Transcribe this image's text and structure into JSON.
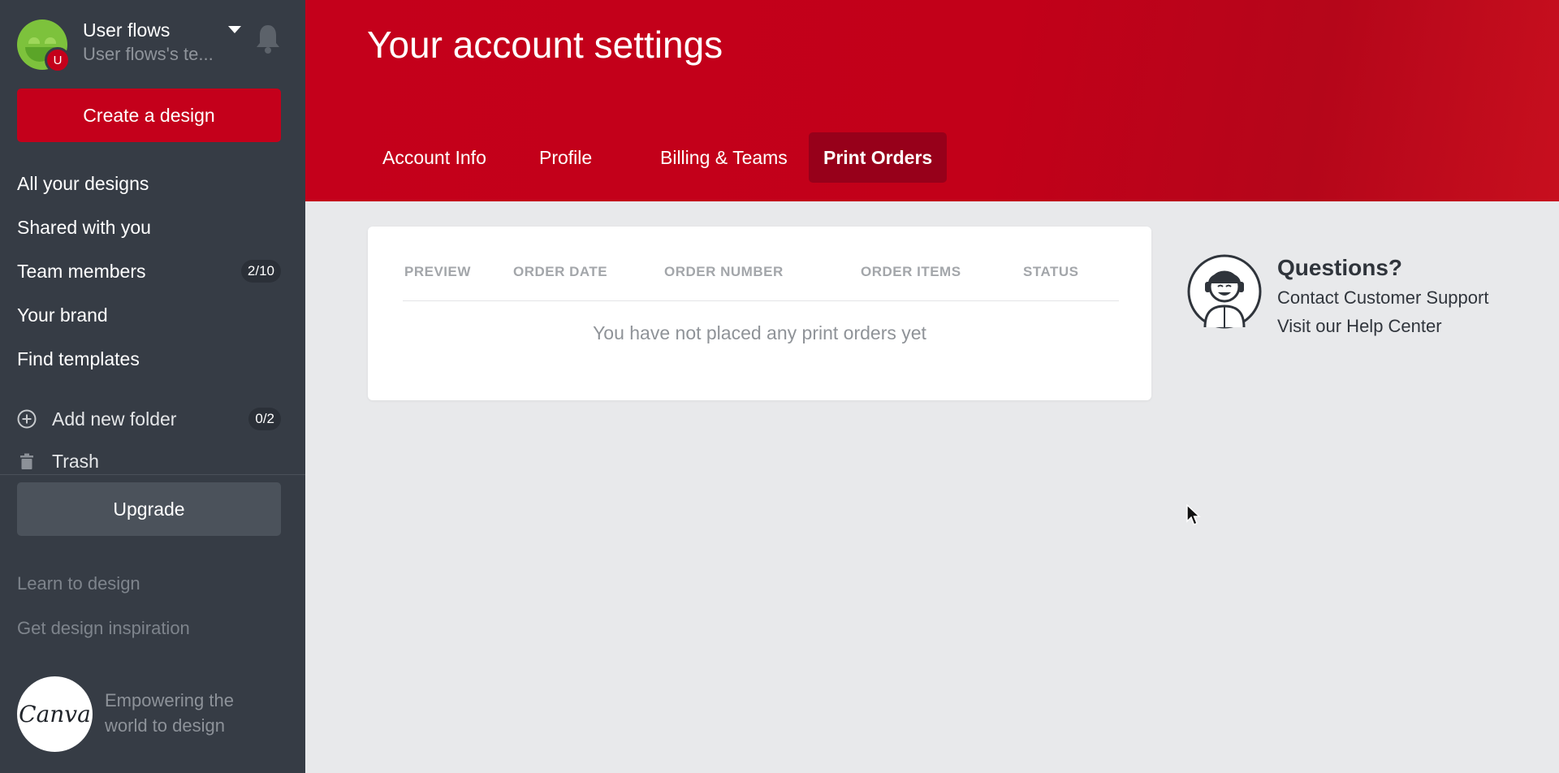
{
  "user": {
    "name": "User flows",
    "team": "User flows's te...",
    "avatar_initial": "U"
  },
  "sidebar": {
    "create_label": "Create a design",
    "nav": [
      {
        "label": "All your designs"
      },
      {
        "label": "Shared with you"
      },
      {
        "label": "Team members",
        "count": "2/10"
      },
      {
        "label": "Your brand"
      },
      {
        "label": "Find templates"
      }
    ],
    "add_folder": {
      "label": "Add new folder",
      "count": "0/2"
    },
    "trash_label": "Trash",
    "upgrade_label": "Upgrade",
    "footer_links": [
      "Learn to design",
      "Get design inspiration"
    ],
    "logo_text": "Canva",
    "tagline": "Empowering the world to design"
  },
  "header": {
    "title": "Your account settings",
    "tabs": [
      {
        "label": "Account Info",
        "active": false
      },
      {
        "label": "Profile",
        "active": false
      },
      {
        "label": "Billing & Teams",
        "active": false
      },
      {
        "label": "Print Orders",
        "active": true
      }
    ]
  },
  "orders": {
    "columns": [
      "PREVIEW",
      "ORDER DATE",
      "ORDER NUMBER",
      "ORDER ITEMS",
      "STATUS"
    ],
    "empty_message": "You have not placed any print orders yet"
  },
  "support": {
    "title": "Questions?",
    "links": [
      "Contact Customer Support",
      "Visit our Help Center"
    ]
  },
  "colors": {
    "brand_red": "#c4001b",
    "sidebar_bg": "#363c45",
    "active_tab": "#97001a",
    "page_bg": "#e8e9eb"
  }
}
